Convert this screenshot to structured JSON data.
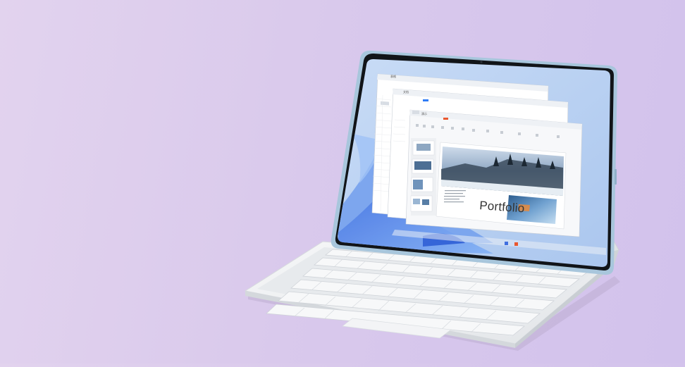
{
  "slide": {
    "title": "Portfolio"
  },
  "windows": {
    "spreadsheet_title": "表格",
    "document_title": "文档",
    "presentation_title": "演示"
  },
  "colors": {
    "background": "#d9c9ec",
    "tablet_frame": "#a9c7dd",
    "keyboard": "#eef0f2",
    "wallpaper": "#b9d3f2"
  }
}
